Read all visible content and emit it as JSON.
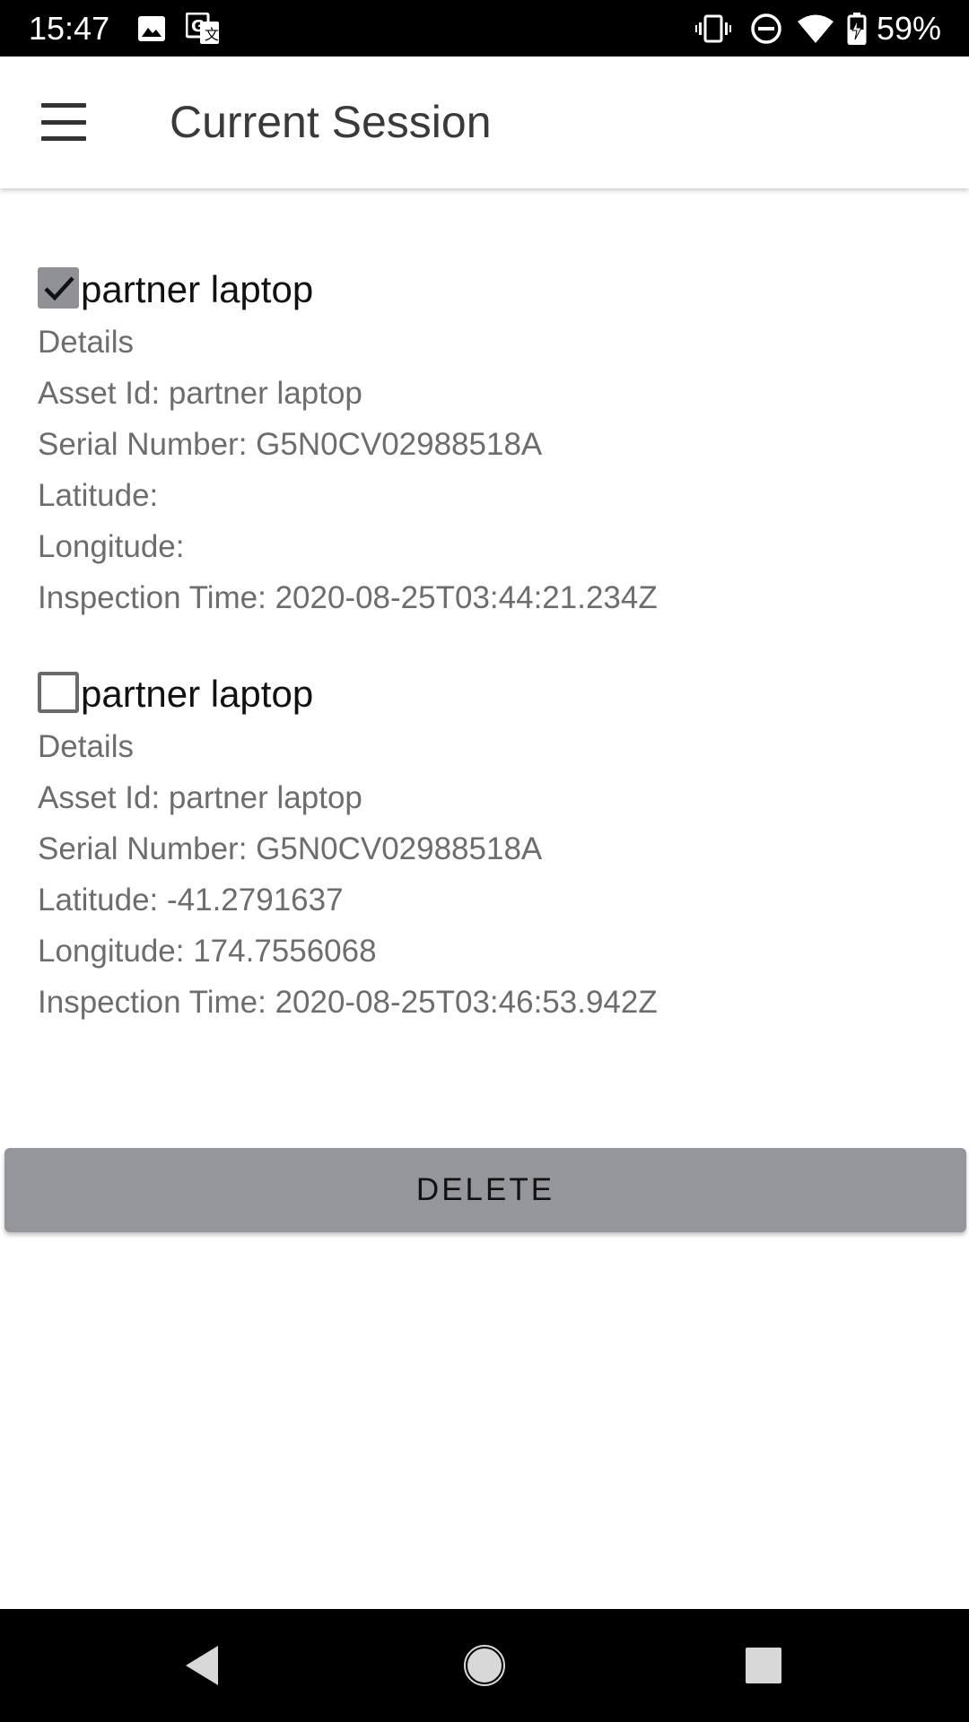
{
  "status_bar": {
    "time": "15:47",
    "battery": "59%",
    "icons": [
      "image-icon",
      "translate-icon",
      "vibrate-icon",
      "do-not-disturb-icon",
      "wifi-icon",
      "battery-charging-icon"
    ]
  },
  "app_bar": {
    "title": "Current Session",
    "menu_icon": "hamburger-menu-icon"
  },
  "items": [
    {
      "checked": true,
      "title": "partner laptop",
      "details_label": "Details",
      "asset_id": "Asset Id: partner laptop",
      "serial": "Serial Number: G5N0CV02988518A",
      "latitude": "Latitude:",
      "longitude": "Longitude:",
      "inspection_time": "Inspection Time: 2020-08-25T03:44:21.234Z"
    },
    {
      "checked": false,
      "title": "partner laptop",
      "details_label": "Details",
      "asset_id": "Asset Id: partner laptop",
      "serial": "Serial Number: G5N0CV02988518A",
      "latitude": "Latitude: -41.2791637",
      "longitude": "Longitude: 174.7556068",
      "inspection_time": "Inspection Time: 2020-08-25T03:46:53.942Z"
    }
  ],
  "delete_button": {
    "label": "DELETE"
  },
  "nav_bar": {
    "icons": [
      "back-icon",
      "home-icon",
      "recents-icon"
    ]
  },
  "colors": {
    "button_bg": "#94969c",
    "checked_bg": "#8f9197",
    "status_bar_bg": "#000000"
  }
}
